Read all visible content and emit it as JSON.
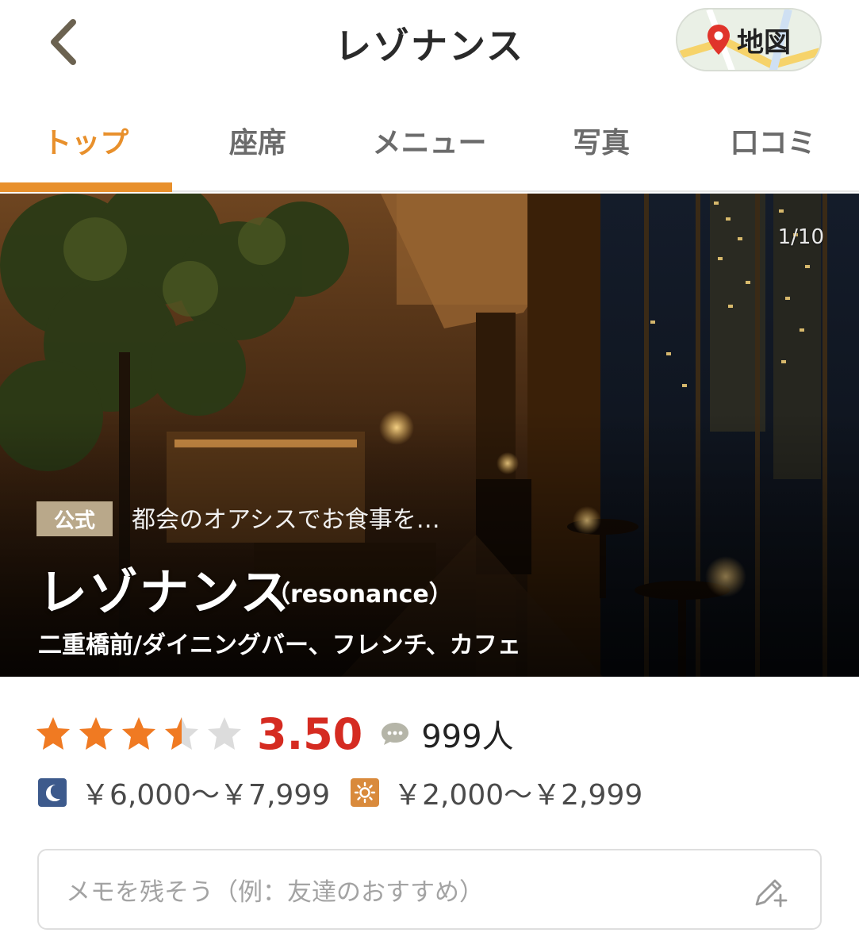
{
  "header": {
    "title": "レゾナンス",
    "map_label": "地図",
    "back_icon": "chevron-left-icon",
    "map_icon": "map-pin-icon"
  },
  "tabs": [
    {
      "label": "トップ",
      "active": true
    },
    {
      "label": "座席",
      "active": false
    },
    {
      "label": "メニュー",
      "active": false
    },
    {
      "label": "写真",
      "active": false
    },
    {
      "label": "口コミ",
      "active": false
    }
  ],
  "hero": {
    "counter": "1/10",
    "badge": "公式",
    "tagline": "都会のオアシスでお食事を…",
    "name": "レゾナンス",
    "name_sub": "（resonance）",
    "category": "二重橋前/ダイニングバー、フレンチ、カフェ"
  },
  "rating": {
    "score": "3.50",
    "stars_value": 3.5,
    "stars_max": 5,
    "review_icon": "speech-bubble-icon",
    "review_count": "999人"
  },
  "prices": {
    "dinner_icon": "moon-icon",
    "dinner": "￥6,000～￥7,999",
    "lunch_icon": "sun-icon",
    "lunch": "￥2,000～￥2,999"
  },
  "memo": {
    "placeholder": "メモを残そう（例：友達のおすすめ）",
    "edit_icon": "pencil-plus-icon"
  },
  "colors": {
    "accent": "#e8902c",
    "score": "#d52b21",
    "star_on": "#f07a22",
    "star_off": "#dcdcdc",
    "badge": "#b9a88a"
  }
}
